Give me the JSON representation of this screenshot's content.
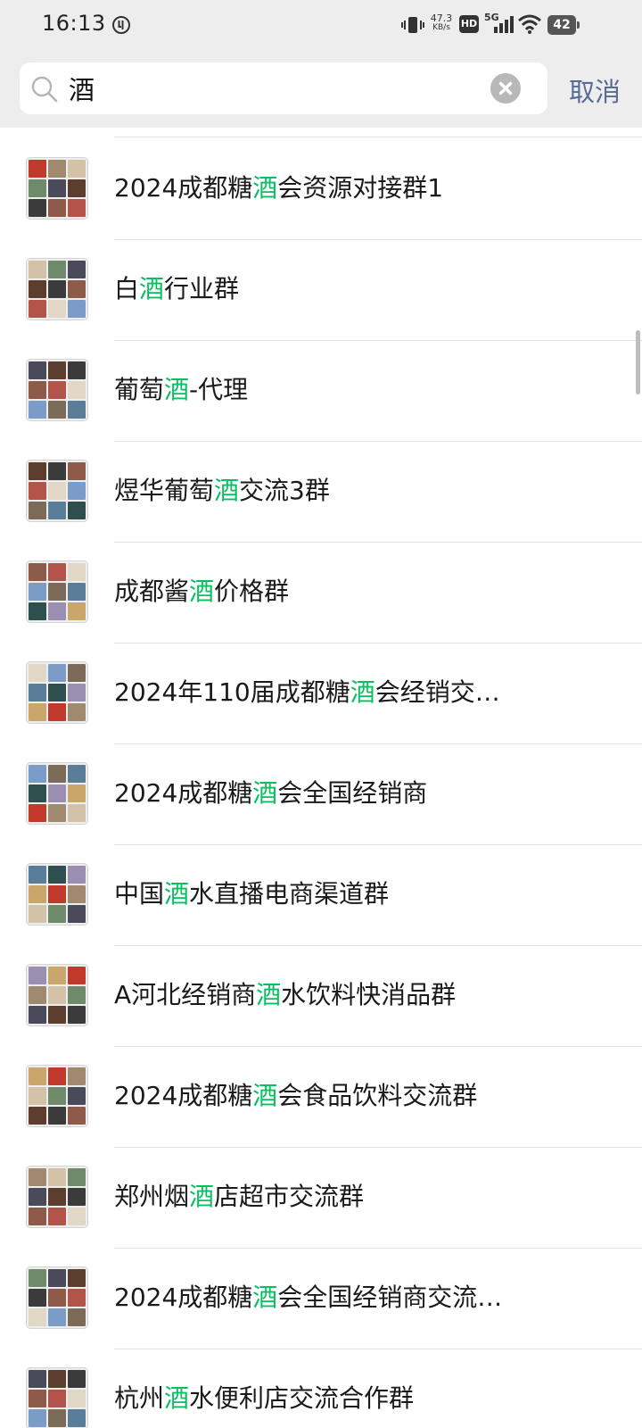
{
  "status_bar": {
    "time": "16:13",
    "net_speed_value": "47.3",
    "net_speed_unit": "KB/s",
    "hd_label": "HD",
    "network_label": "5G",
    "battery": "42",
    "icons": [
      "app-status-icon",
      "vibrate-icon",
      "hd-icon",
      "signal-icon",
      "wifi-icon",
      "battery-icon"
    ]
  },
  "search": {
    "query": "酒",
    "cancel_label": "取消"
  },
  "results": [
    {
      "prefix": "2024成都糖",
      "match": "酒",
      "suffix": "会资源对接群1"
    },
    {
      "prefix": "白",
      "match": "酒",
      "suffix": "行业群"
    },
    {
      "prefix": "葡萄",
      "match": "酒",
      "suffix": "-代理"
    },
    {
      "prefix": "煜华葡萄",
      "match": "酒",
      "suffix": "交流3群"
    },
    {
      "prefix": "成都酱",
      "match": "酒",
      "suffix": "价格群"
    },
    {
      "prefix": "2024年110届成都糖",
      "match": "酒",
      "suffix": "会经销交…"
    },
    {
      "prefix": "2024成都糖",
      "match": "酒",
      "suffix": "会全国经销商"
    },
    {
      "prefix": "中国",
      "match": "酒",
      "suffix": "水直播电商渠道群"
    },
    {
      "prefix": "A河北经销商",
      "match": "酒",
      "suffix": "水饮料快消品群"
    },
    {
      "prefix": "2024成都糖",
      "match": "酒",
      "suffix": "会食品饮料交流群"
    },
    {
      "prefix": "郑州烟",
      "match": "酒",
      "suffix": "店超市交流群"
    },
    {
      "prefix": "2024成都糖",
      "match": "酒",
      "suffix": "会全国经销商交流…"
    },
    {
      "prefix": "杭州",
      "match": "酒",
      "suffix": "水便利店交流合作群"
    }
  ],
  "colors": {
    "highlight": "#07c160",
    "cancel": "#576b95",
    "header_bg": "#ededed"
  }
}
